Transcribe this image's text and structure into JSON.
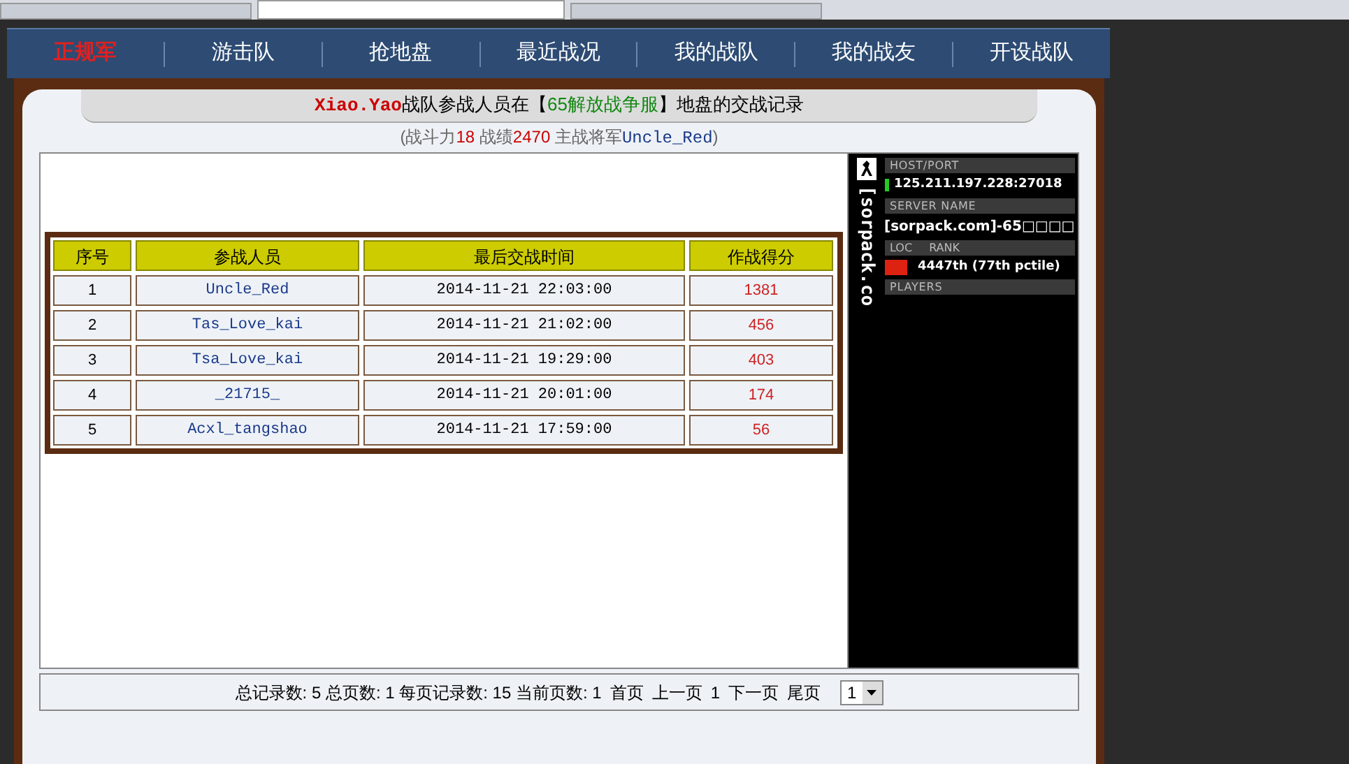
{
  "browser_tabs": [
    {
      "selected": false
    },
    {
      "selected": true
    },
    {
      "selected": false
    }
  ],
  "nav": [
    {
      "label": "正规军",
      "selected": true
    },
    {
      "label": "游击队",
      "selected": false
    },
    {
      "label": "抢地盘",
      "selected": false
    },
    {
      "label": "最近战况",
      "selected": false
    },
    {
      "label": "我的战队",
      "selected": false
    },
    {
      "label": "我的战友",
      "selected": false
    },
    {
      "label": "开设战队",
      "selected": false
    }
  ],
  "heading": {
    "team": "Xiao.Yao",
    "middle": "战队参战人员在【",
    "server": "65解放战争服",
    "end": "】地盘的交战记录"
  },
  "stats": {
    "open": "(战斗力",
    "power": "18",
    "record_label": " 战绩",
    "record": "2470",
    "general_label": " 主战将军",
    "general": "Uncle_Red",
    "close": ")"
  },
  "table": {
    "columns": [
      "序号",
      "参战人员",
      "最后交战时间",
      "作战得分"
    ],
    "rows": [
      {
        "no": "1",
        "player": "Uncle_Red",
        "time": "2014-11-21 22:03:00",
        "score": "1381"
      },
      {
        "no": "2",
        "player": "Tas_Love_kai",
        "time": "2014-11-21 21:02:00",
        "score": "456"
      },
      {
        "no": "3",
        "player": "Tsa_Love_kai",
        "time": "2014-11-21 19:29:00",
        "score": "403"
      },
      {
        "no": "4",
        "player": "_21715_",
        "time": "2014-11-21 20:01:00",
        "score": "174"
      },
      {
        "no": "5",
        "player": "Acxl_tangshao",
        "time": "2014-11-21 17:59:00",
        "score": "56"
      }
    ]
  },
  "server_widget": {
    "brand": "[sorpack.co",
    "host_label": "HOST/PORT",
    "host": "125.211.197.228:27018",
    "name_label": "SERVER NAME",
    "name": "[sorpack.com]-65□□□□",
    "loc_label": "LOC",
    "rank_label": "RANK",
    "rank": "4447th (77th pctile)",
    "players_label": "PLAYERS"
  },
  "pagination": {
    "summary": "总记录数: 5 总页数: 1 每页记录数: 15 当前页数: 1",
    "first": "首页",
    "prev": "上一页",
    "current": "1",
    "next": "下一页",
    "last": "尾页",
    "page_select": "1"
  }
}
